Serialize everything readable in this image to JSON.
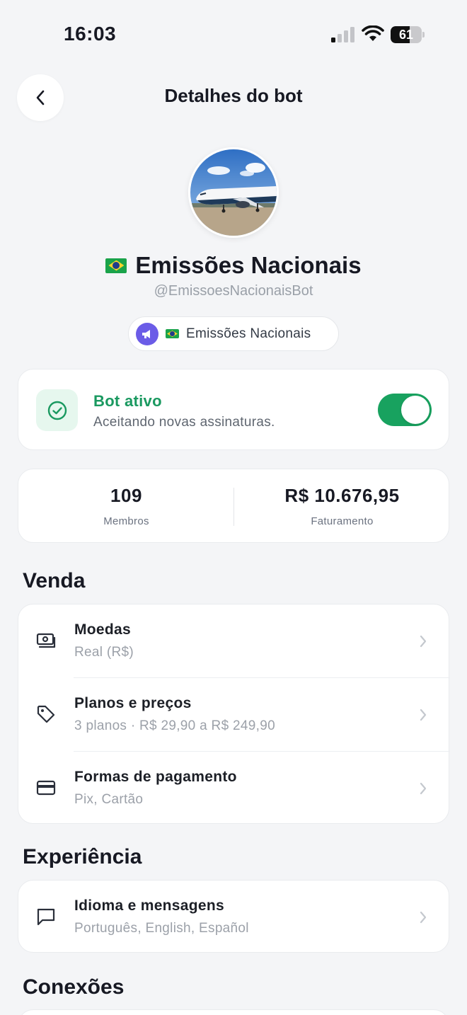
{
  "status_bar": {
    "time": "16:03",
    "battery": "61",
    "battery_level": 0.61
  },
  "header": {
    "title": "Detalhes do bot"
  },
  "profile": {
    "name": "Emissões Nacionais",
    "handle": "@EmissoesNacionaisBot",
    "channel": "Emissões Nacionais"
  },
  "bot_status": {
    "title": "Bot ativo",
    "subtitle": "Aceitando novas assinaturas.",
    "enabled": true,
    "accent": "#1a9960"
  },
  "stats": [
    {
      "value": "109",
      "label": "Membros"
    },
    {
      "value": "R$ 10.676,95",
      "label": "Faturamento"
    }
  ],
  "sections": {
    "venda": {
      "title": "Venda",
      "items": [
        {
          "title": "Moedas",
          "subtitle": "Real (R$)",
          "icon": "cash-icon"
        },
        {
          "title": "Planos e preços",
          "subtitle": "3 planos · R$ 29,90 a R$ 249,90",
          "icon": "tag-icon"
        },
        {
          "title": "Formas de pagamento",
          "subtitle": "Pix, Cartão",
          "icon": "credit-card-icon"
        }
      ]
    },
    "experiencia": {
      "title": "Experiência",
      "items": [
        {
          "title": "Idioma e mensagens",
          "subtitle": "Português, English, Español",
          "icon": "message-icon"
        }
      ]
    },
    "conexoes": {
      "title": "Conexões"
    }
  }
}
